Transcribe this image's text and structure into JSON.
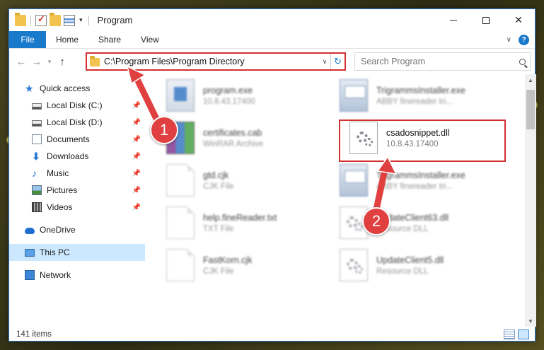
{
  "window": {
    "title": "Program"
  },
  "ribbon": {
    "tabs": [
      "File",
      "Home",
      "Share",
      "View"
    ]
  },
  "address": {
    "path": "C:\\Program Files\\Program Directory"
  },
  "search": {
    "placeholder": "Search Program"
  },
  "sidebar": {
    "quick_access": "Quick access",
    "items": [
      {
        "label": "Local Disk (C:)",
        "icon": "disk-icon",
        "pinned": true
      },
      {
        "label": "Local Disk (D:)",
        "icon": "disk-icon",
        "pinned": true
      },
      {
        "label": "Documents",
        "icon": "documents-icon",
        "pinned": true
      },
      {
        "label": "Downloads",
        "icon": "downloads-icon",
        "pinned": true
      },
      {
        "label": "Music",
        "icon": "music-icon",
        "pinned": true
      },
      {
        "label": "Pictures",
        "icon": "pictures-icon",
        "pinned": true
      },
      {
        "label": "Videos",
        "icon": "videos-icon",
        "pinned": true
      }
    ],
    "onedrive": "OneDrive",
    "this_pc": "This PC",
    "network": "Network"
  },
  "files": [
    {
      "name": "program.exe",
      "sub": "10.8.43.17400",
      "icon": "exe-icon"
    },
    {
      "name": "TrigrammsInstaller.exe",
      "sub": "ABBY finereader tri...",
      "icon": "setup-icon"
    },
    {
      "name": "certificates.cab",
      "sub": "WinRAR Archive",
      "icon": "winrar-icon"
    },
    {
      "name": "csadosnippet.dll",
      "sub": "10.8.43.17400",
      "icon": "dll-icon"
    },
    {
      "name": "gtd.cjk",
      "sub": "CJK File",
      "icon": "document-icon"
    },
    {
      "name": "TrigrammsInstaller.exe",
      "sub": "ABBY finereader tri...",
      "icon": "setup-icon"
    },
    {
      "name": "help.fineReader.txt",
      "sub": "TXT File",
      "icon": "document-icon"
    },
    {
      "name": "UpdateClient63.dll",
      "sub": "Resource DLL",
      "icon": "dll-icon"
    },
    {
      "name": "FastKorn.cjk",
      "sub": "CJK File",
      "icon": "document-icon"
    },
    {
      "name": "UpdateClient5.dll",
      "sub": "Resource DLL",
      "icon": "dll-icon"
    }
  ],
  "status": {
    "items": "141 items"
  },
  "annotations": {
    "step1": "1",
    "step2": "2",
    "color": "#d32f2f"
  }
}
